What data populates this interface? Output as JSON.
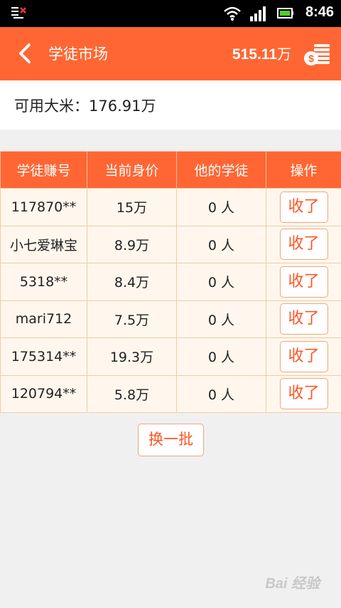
{
  "status_bar": {
    "time": "8:46",
    "icons": [
      "notification-icon",
      "wifi-icon",
      "signal-icon",
      "battery-icon"
    ]
  },
  "header": {
    "title": "学徒市场",
    "balance_value": "515.11",
    "balance_unit": "万",
    "back_icon": "chevron-left-icon",
    "coins_icon": "coins-icon"
  },
  "available": {
    "text": "可用大米：176.91万"
  },
  "table": {
    "headers": [
      "学徒赚号",
      "当前身价",
      "他的学徒",
      "操作"
    ],
    "rows": [
      {
        "account": "117870**",
        "price": "15万",
        "disciples": "0 人",
        "action": "收了"
      },
      {
        "account": "小七爱琳宝",
        "price": "8.9万",
        "disciples": "0 人",
        "action": "收了"
      },
      {
        "account": "5318**",
        "price": "8.4万",
        "disciples": "0 人",
        "action": "收了"
      },
      {
        "account": "mari712",
        "price": "7.5万",
        "disciples": "0 人",
        "action": "收了"
      },
      {
        "account": "175314**",
        "price": "19.3万",
        "disciples": "0 人",
        "action": "收了"
      },
      {
        "account": "120794**",
        "price": "5.8万",
        "disciples": "0 人",
        "action": "收了"
      }
    ]
  },
  "refresh_label": "换一批",
  "watermark": "Bai 经验",
  "colors": {
    "accent": "#ff6633",
    "button_text": "#ff5522",
    "cell_bg": "#fff7ee",
    "border": "#f5c9a0"
  }
}
